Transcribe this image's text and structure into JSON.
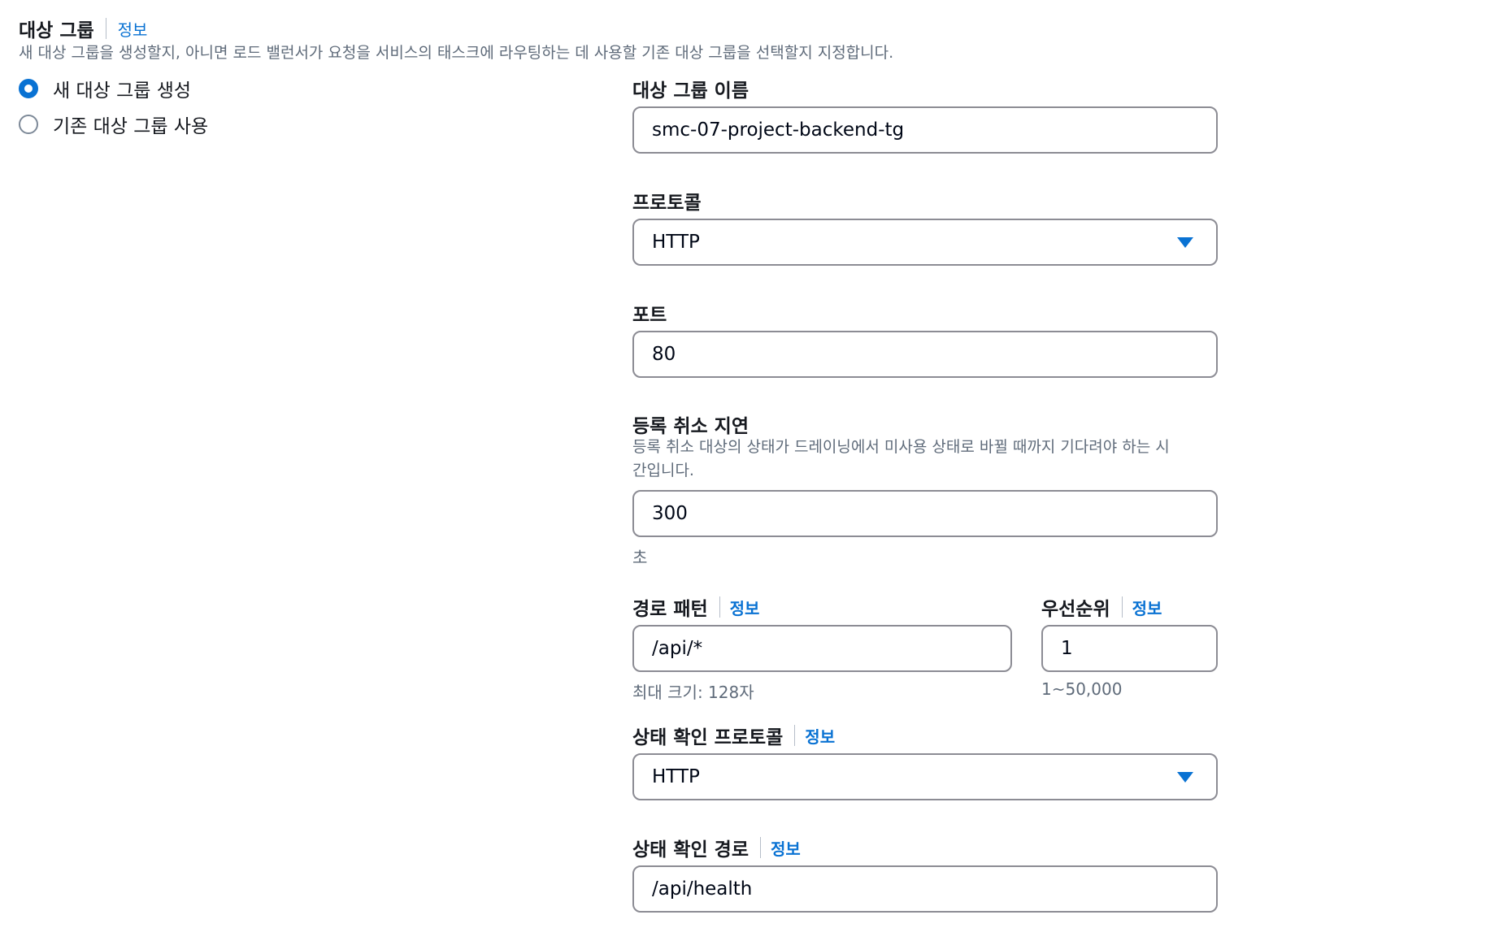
{
  "target_group": {
    "title": "대상 그룹",
    "info": "정보",
    "description": "새 대상 그룹을 생성할지, 아니면 로드 밸런서가 요청을 서비스의 태스크에 라우팅하는 데 사용할 기존 대상 그룹을 선택할지 지정합니다.",
    "options": [
      {
        "label": "새 대상 그룹 생성",
        "selected": true
      },
      {
        "label": "기존 대상 그룹 사용",
        "selected": false
      }
    ]
  },
  "fields": {
    "name": {
      "label": "대상 그룹 이름",
      "value": "smc-07-project-backend-tg"
    },
    "protocol": {
      "label": "프로토콜",
      "value": "HTTP"
    },
    "port": {
      "label": "포트",
      "value": "80"
    },
    "deregistration": {
      "label": "등록 취소 지연",
      "description_line1": "등록 취소 대상의 상태가 드레이닝에서 미사용 상태로 바뀔 때까지 기다려야 하는 시",
      "description_line2": "간입니다.",
      "value": "300",
      "unit": "초"
    },
    "path_pattern": {
      "label": "경로 패턴",
      "info": "정보",
      "value": "/api/*",
      "hint": "최대 크기: 128자"
    },
    "priority": {
      "label": "우선순위",
      "info": "정보",
      "value": "1",
      "hint": "1~50,000"
    },
    "health_protocol": {
      "label": "상태 확인 프로토콜",
      "info": "정보",
      "value": "HTTP"
    },
    "health_path": {
      "label": "상태 확인 경로",
      "info": "정보",
      "value": "/api/health"
    }
  },
  "colors": {
    "accent": "#0972d3",
    "text": "#16191f",
    "muted": "#5f6b7a",
    "border": "#8c8c94"
  }
}
